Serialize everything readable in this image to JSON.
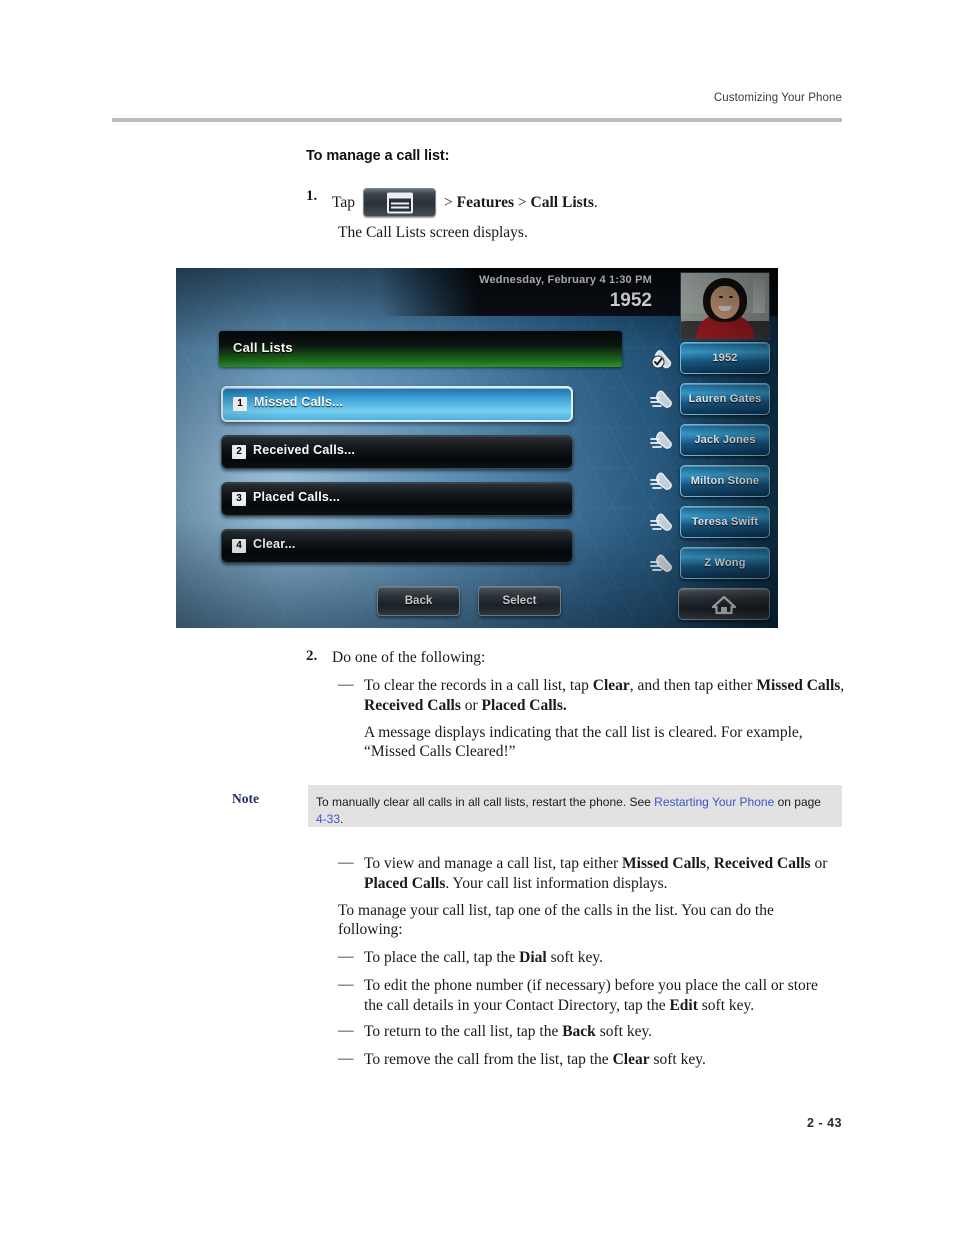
{
  "header": {
    "running_head": "Customizing Your Phone"
  },
  "section": {
    "heading": "To manage a call list:"
  },
  "steps": {
    "one": {
      "number": "1.",
      "lead": "Tap",
      "menu_key_icon": "menu-key-icon",
      "path": "> Features > Call Lists.",
      "path_pre": ">",
      "path_features": "Features",
      "path_sep": ">",
      "path_calllists": "Call Lists",
      "path_end": ".",
      "result": "The Call Lists screen displays."
    },
    "two": {
      "number": "2.",
      "lead": "Do one of the following:",
      "bullet1": {
        "dash": "—",
        "t1": "To clear the records in a call list, tap ",
        "b1": "Clear",
        "t2": ", and then tap either ",
        "b2": "Missed Calls",
        "t3": ", ",
        "b3": "Received Calls",
        "t4": " or ",
        "b4": "Placed Calls."
      },
      "bullet1_note": "A message displays indicating that the call list is cleared. For example, “Missed Calls Cleared!”",
      "bullet2": {
        "dash": "—",
        "t1": "To view and manage a call list, tap either ",
        "b1": "Missed Calls",
        "t2": ", ",
        "b2": "Received Calls",
        "t3": " or ",
        "b3": "Placed Calls",
        "t4": ". Your call list information displays."
      },
      "manage_para": "To manage your call list, tap one of the calls in the list. You can do the following:",
      "actions": [
        {
          "dash": "—",
          "t1": "To place the call, tap the ",
          "b1": "Dial",
          "t2": " soft key."
        },
        {
          "dash": "—",
          "t1": "To edit the phone number (if necessary) before you place the call or store the call details in your Contact Directory, tap the ",
          "b1": "Edit",
          "t2": " soft key."
        },
        {
          "dash": "—",
          "t1": "To return to the call list, tap the ",
          "b1": "Back",
          "t2": " soft key."
        },
        {
          "dash": "—",
          "t1": "To remove the call from the list, tap the ",
          "b1": "Clear",
          "t2": " soft key."
        }
      ]
    }
  },
  "note": {
    "label": "Note",
    "t1": "To manually clear all calls in all call lists, restart the phone. See ",
    "link1": "Restarting Your Phone",
    "t2": " on page ",
    "link2": "4-33",
    "t3": "."
  },
  "phone_screen": {
    "status_date": "Wednesday, February 4  1:30 PM",
    "status_extension": "1952",
    "title": "Call Lists",
    "menu_items": [
      {
        "index": "1",
        "label": "Missed Calls...",
        "selected": true
      },
      {
        "index": "2",
        "label": "Received Calls...",
        "selected": false
      },
      {
        "index": "3",
        "label": "Placed Calls...",
        "selected": false
      },
      {
        "index": "4",
        "label": "Clear...",
        "selected": false
      }
    ],
    "line_keys": [
      {
        "label": "1952",
        "icon": "handset-check-icon"
      },
      {
        "label": "Lauren Gates",
        "icon": "handset-lines-icon"
      },
      {
        "label": "Jack Jones",
        "icon": "handset-lines-icon"
      },
      {
        "label": "Milton Stone",
        "icon": "handset-lines-icon"
      },
      {
        "label": "Teresa Swift",
        "icon": "handset-lines-icon"
      },
      {
        "label": "Z Wong",
        "icon": "handset-lines-icon"
      }
    ],
    "soft_keys": [
      "Back",
      "Select"
    ],
    "home_key_icon": "home-icon",
    "colors": {
      "title_accent": "#2f9527",
      "selected_item": "#76d0f0",
      "line_key": "#3ba3d6"
    }
  },
  "footer": {
    "page_number": "2 - 43"
  }
}
